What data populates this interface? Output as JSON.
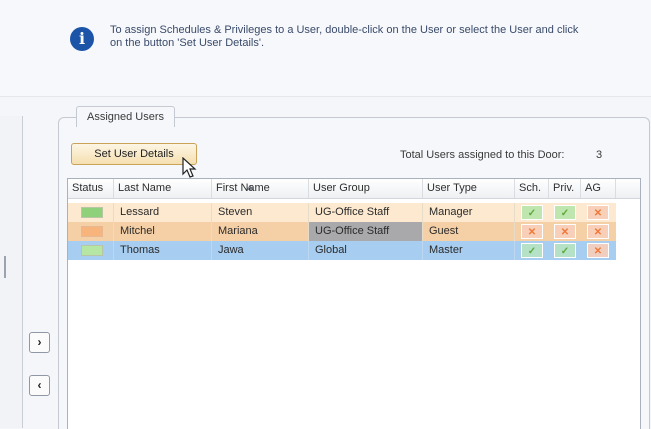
{
  "info": {
    "line1": "To assign Schedules & Privileges to a User, double-click on the User or select the User and click",
    "line2": "on the button 'Set User Details'."
  },
  "group": {
    "title": "Assigned Users",
    "set_button_label": "Set User Details",
    "total_label": "Total Users assigned to this Door:",
    "total_count": "3"
  },
  "grid": {
    "headers": {
      "status": "Status",
      "last_name": "Last Name",
      "first_name": "First Name",
      "user_group": "User Group",
      "user_type": "User Type",
      "sch": "Sch.",
      "priv": "Priv.",
      "ag": "AG"
    },
    "sort": {
      "column": "Last Name",
      "direction": "ascending"
    },
    "rows": [
      {
        "status": "active",
        "last_name": "Lessard",
        "first_name": "Steven",
        "user_group": "UG-Office Staff",
        "user_type": "Manager",
        "sch": "yes",
        "priv": "yes",
        "ag": "no"
      },
      {
        "status": "inactive",
        "last_name": "Mitchel",
        "first_name": "Mariana",
        "user_group": "UG-Office Staff",
        "user_type": "Guest",
        "sch": "no",
        "priv": "no",
        "ag": "no"
      },
      {
        "status": "active",
        "last_name": "Thomas",
        "first_name": "Jawa",
        "user_group": "Global",
        "user_type": "Master",
        "sch": "yes",
        "priv": "yes",
        "ag": "no"
      }
    ]
  },
  "icons": {
    "info": "info-icon",
    "cursor": "mouse-pointer-icon",
    "yes_mark": "✓",
    "no_mark": "✕"
  },
  "nav": {
    "add": "›",
    "remove": "‹"
  },
  "colors": {
    "selected_row": "#a7cdf0",
    "highlight_row": "#fde9cf",
    "check_green": "#5da93e",
    "cross_orange": "#f07838",
    "button_face": "#f5dfb0"
  }
}
